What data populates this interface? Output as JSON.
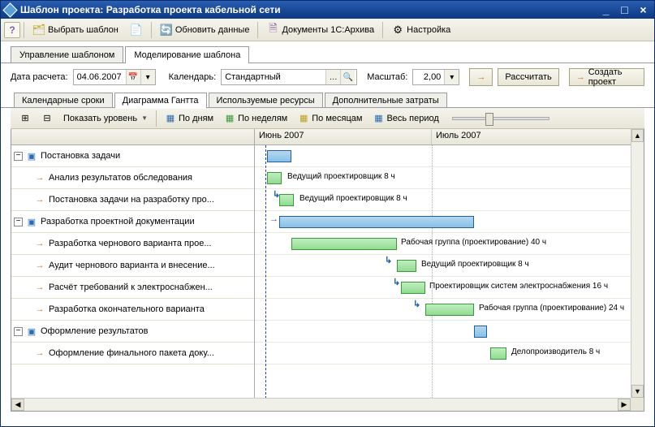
{
  "window": {
    "title": "Шаблон проекта: Разработка проекта кабельной сети"
  },
  "toolbar": {
    "select_template": "Выбрать шаблон",
    "refresh": "Обновить данные",
    "documents": "Документы 1С:Архива",
    "settings": "Настройка"
  },
  "mainTabs": {
    "manage": "Управление шаблоном",
    "model": "Моделирование шаблона"
  },
  "params": {
    "date_label": "Дата расчета:",
    "date_value": "04.06.2007",
    "calendar_label": "Календарь:",
    "calendar_value": "Стандартный",
    "scale_label": "Масштаб:",
    "scale_value": "2,00",
    "calc": "Рассчитать",
    "create": "Создать проект"
  },
  "subTabs": {
    "dates": "Календарные сроки",
    "gantt": "Диаграмма Гантта",
    "resources": "Используемые ресурсы",
    "costs": "Дополнительные затраты"
  },
  "ganttToolbar": {
    "show_level": "Показать уровень",
    "by_days": "По дням",
    "by_weeks": "По неделям",
    "by_months": "По месяцам",
    "full_period": "Весь период"
  },
  "timeline": {
    "month1": "Июнь 2007",
    "month2": "Июль 2007"
  },
  "tasks": [
    {
      "label": "Постановка задачи",
      "group": true,
      "indent": 0
    },
    {
      "label": "Анализ результатов обследования",
      "group": false,
      "indent": 1
    },
    {
      "label": "Постановка задачи на разработку про...",
      "group": false,
      "indent": 1
    },
    {
      "label": "Разработка проектной документации",
      "group": true,
      "indent": 0
    },
    {
      "label": "Разработка чернового варианта прое...",
      "group": false,
      "indent": 1
    },
    {
      "label": "Аудит чернового варианта и внесение...",
      "group": false,
      "indent": 1
    },
    {
      "label": "Расчёт требований к электроснабжен...",
      "group": false,
      "indent": 1
    },
    {
      "label": "Разработка окончательного варианта",
      "group": false,
      "indent": 1
    },
    {
      "label": "Оформление результатов",
      "group": true,
      "indent": 0
    },
    {
      "label": "Оформление финального пакета доку...",
      "group": false,
      "indent": 1
    }
  ],
  "barLabels": {
    "b1": "Ведущий проектировщик 8 ч",
    "b2": "Ведущий проектировщик 8 ч",
    "b3": "Рабочая группа (проектирование) 40 ч",
    "b4": "Ведущий проектировщик 8 ч",
    "b5": "Проектировщик систем электроснабжения 16 ч",
    "b6": "Рабочая группа (проектирование) 24 ч",
    "b7": "Делопроизводитель 8 ч"
  },
  "chart_data": {
    "type": "gantt",
    "time_axis": {
      "unit": "week",
      "range": [
        "2007-06-01",
        "2007-07-31"
      ],
      "today": "2007-06-04"
    },
    "tasks": [
      {
        "name": "Постановка задачи",
        "type": "summary",
        "start": "2007-06-04",
        "end": "2007-06-06"
      },
      {
        "name": "Анализ результатов обследования",
        "type": "task",
        "start": "2007-06-04",
        "end": "2007-06-05",
        "resource": "Ведущий проектировщик 8 ч"
      },
      {
        "name": "Постановка задачи на разработку проекта",
        "type": "task",
        "start": "2007-06-05",
        "end": "2007-06-06",
        "resource": "Ведущий проектировщик 8 ч"
      },
      {
        "name": "Разработка проектной документации",
        "type": "summary",
        "start": "2007-06-06",
        "end": "2007-07-02"
      },
      {
        "name": "Разработка чернового варианта проекта",
        "type": "task",
        "start": "2007-06-06",
        "end": "2007-06-20",
        "resource": "Рабочая группа (проектирование) 40 ч"
      },
      {
        "name": "Аудит чернового варианта и внесение изменений",
        "type": "task",
        "start": "2007-06-20",
        "end": "2007-06-21",
        "resource": "Ведущий проектировщик 8 ч"
      },
      {
        "name": "Расчёт требований к электроснабжению",
        "type": "task",
        "start": "2007-06-21",
        "end": "2007-06-25",
        "resource": "Проектировщик систем электроснабжения 16 ч"
      },
      {
        "name": "Разработка окончательного варианта",
        "type": "task",
        "start": "2007-06-25",
        "end": "2007-07-02",
        "resource": "Рабочая группа (проектирование) 24 ч"
      },
      {
        "name": "Оформление результатов",
        "type": "summary",
        "start": "2007-07-02",
        "end": "2007-07-03"
      },
      {
        "name": "Оформление финального пакета документов",
        "type": "task",
        "start": "2007-07-09",
        "end": "2007-07-10",
        "resource": "Делопроизводитель 8 ч"
      }
    ]
  }
}
